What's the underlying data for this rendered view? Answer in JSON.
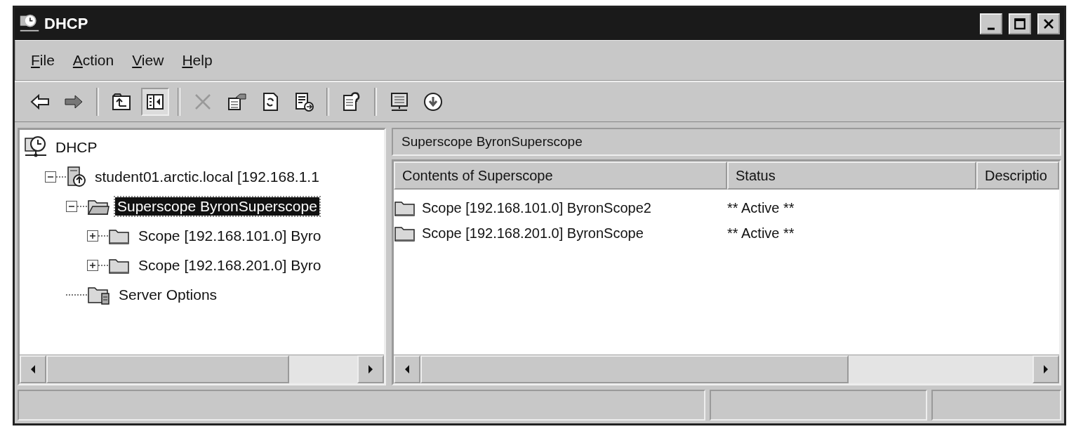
{
  "window": {
    "title": "DHCP"
  },
  "menu": [
    "File",
    "Action",
    "View",
    "Help"
  ],
  "toolbar": [
    {
      "kind": "back",
      "disabled": false,
      "pressed": false
    },
    {
      "kind": "forward",
      "disabled": false,
      "pressed": false
    },
    {
      "kind": "sep"
    },
    {
      "kind": "up",
      "disabled": false,
      "pressed": false
    },
    {
      "kind": "tree",
      "disabled": false,
      "pressed": true
    },
    {
      "kind": "sep"
    },
    {
      "kind": "delete",
      "disabled": true,
      "pressed": false
    },
    {
      "kind": "properties",
      "disabled": false,
      "pressed": false
    },
    {
      "kind": "refresh",
      "disabled": false,
      "pressed": false
    },
    {
      "kind": "export",
      "disabled": false,
      "pressed": false
    },
    {
      "kind": "sep"
    },
    {
      "kind": "help",
      "disabled": false,
      "pressed": false
    },
    {
      "kind": "sep"
    },
    {
      "kind": "monitor",
      "disabled": false,
      "pressed": false
    },
    {
      "kind": "down",
      "disabled": false,
      "pressed": false
    }
  ],
  "tree": [
    {
      "label": "DHCP",
      "kind": "root",
      "selected": false,
      "children": [
        {
          "label": "student01.arctic.local [192.168.1.1",
          "kind": "server",
          "selected": false,
          "expanded": true,
          "children": [
            {
              "label": "Superscope ByronSuperscope",
              "kind": "superscope",
              "selected": true,
              "expanded": true,
              "children": [
                {
                  "label": "Scope [192.168.101.0] Byro",
                  "kind": "scope",
                  "selected": false,
                  "expanded": false
                },
                {
                  "label": "Scope [192.168.201.0] Byro",
                  "kind": "scope",
                  "selected": false,
                  "expanded": false
                }
              ]
            },
            {
              "label": "Server Options",
              "kind": "options",
              "selected": false
            }
          ]
        }
      ]
    }
  ],
  "details": {
    "title": "Superscope ByronSuperscope",
    "columns": [
      "Contents of Superscope",
      "Status",
      "Descriptio"
    ],
    "rows": [
      {
        "cells": [
          "Scope [192.168.101.0] ByronScope2",
          "** Active **"
        ]
      },
      {
        "cells": [
          "Scope [192.168.201.0] ByronScope",
          "** Active **"
        ]
      }
    ]
  }
}
